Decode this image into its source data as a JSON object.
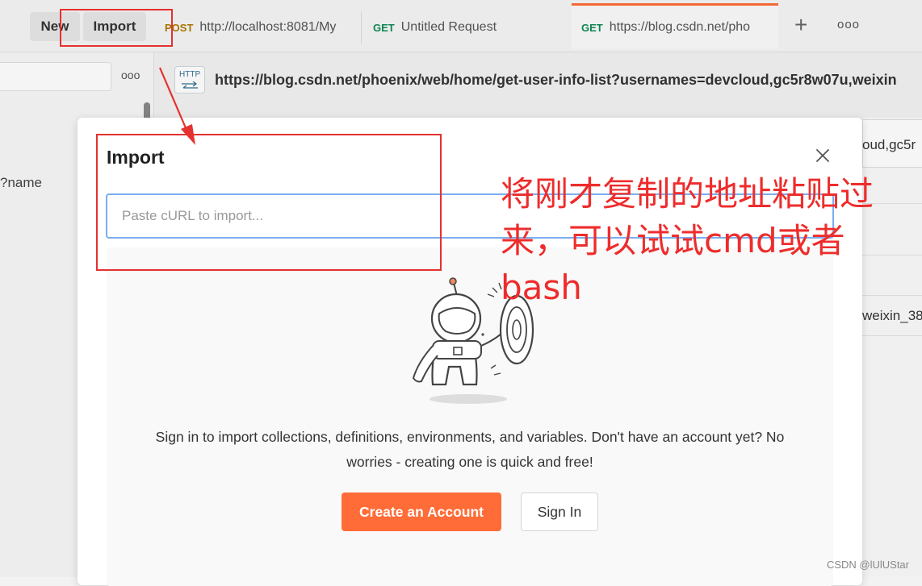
{
  "toolbar": {
    "new_label": "New",
    "import_label": "Import"
  },
  "tabs": [
    {
      "method": "POST",
      "title": "http://localhost:8081/My"
    },
    {
      "method": "GET",
      "title": "Untitled Request"
    },
    {
      "method": "GET",
      "title": "https://blog.csdn.net/pho"
    }
  ],
  "tab_actions": {
    "add": "+",
    "more": "ooo"
  },
  "sidebar": {
    "more": "ooo",
    "item": "?name"
  },
  "request": {
    "protocol_icon": "HTTP",
    "url": "https://blog.csdn.net/phoenix/web/home/get-user-info-list?usernames=devcloud,gc5r8w07u,weixin"
  },
  "right_panel": {
    "line1": "oud,gc5r",
    "line2": "weixin_38"
  },
  "modal": {
    "title": "Import",
    "curl_placeholder": "Paste cURL to import...",
    "signin_text": "Sign in to import collections, definitions, environments, and variables. Don't have an account yet? No worries - creating one is quick and free!",
    "create_account": "Create an Account",
    "sign_in": "Sign In"
  },
  "annotation": {
    "note": "将刚才复制的地址粘贴过来，可以试试cmd或者bash",
    "color": "#ee2c2c"
  },
  "watermark": "CSDN @lUlUStar",
  "colors": {
    "accent": "#ff6c37",
    "input_focus": "#7aaef1",
    "annotation": "#e5312f"
  }
}
